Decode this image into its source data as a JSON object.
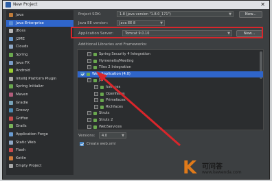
{
  "window": {
    "title": "New Project",
    "close_glyph": "✕"
  },
  "sidebar": {
    "items": [
      {
        "label": "Java",
        "color": "#c07c3a"
      },
      {
        "label": "Java Enterprise",
        "color": "#5a8ed6",
        "selected": true
      },
      {
        "label": "JBoss",
        "color": "#b7b7b7"
      },
      {
        "label": "J2ME",
        "color": "#6a9bd1"
      },
      {
        "label": "Clouds",
        "color": "#8fa7c4"
      },
      {
        "label": "Spring",
        "color": "#6aa84f"
      },
      {
        "label": "Java FX",
        "color": "#7a9cc6"
      },
      {
        "label": "Android",
        "color": "#9acd32"
      },
      {
        "label": "IntelliJ Platform Plugin",
        "color": "#a8a8a8"
      },
      {
        "label": "Spring Initializr",
        "color": "#6aa84f"
      },
      {
        "label": "Maven",
        "color": "#b05c7a"
      },
      {
        "label": "Gradle",
        "color": "#78a3b8"
      },
      {
        "label": "Groovy",
        "color": "#4e8ab3"
      },
      {
        "label": "Griffon",
        "color": "#c94b4b"
      },
      {
        "label": "Grails",
        "color": "#7ab35a"
      },
      {
        "label": "Application Forge",
        "color": "#6a9bd1"
      },
      {
        "label": "Static Web",
        "color": "#8fa7c4"
      },
      {
        "label": "Flash",
        "color": "#c94b4b"
      },
      {
        "label": "Kotlin",
        "color": "#d17a3a"
      },
      {
        "label": "Empty Project",
        "color": "#a8a8a8"
      }
    ]
  },
  "form": {
    "sdk_label": "Project SDK:",
    "sdk_value": "1.8 (java version \"1.8.0_171\")",
    "sdk_new_button": "New...",
    "javaee_label": "Java EE version:",
    "javaee_value": "Java EE 8",
    "server_label": "Application Server:",
    "server_value": "Tomcat 9.0.10",
    "server_new_button": "New...",
    "libraries_label": "Additional Libraries and Frameworks:",
    "versions_label": "Versions:",
    "versions_value": "4.0",
    "create_webxml_label": "Create web.xml"
  },
  "tree": {
    "rows": [
      {
        "label": "Spring Security 4 Integration",
        "indent": 1,
        "checked": false
      },
      {
        "label": "Hymenetis/Meeting",
        "indent": 1,
        "checked": false
      },
      {
        "label": "Tiles 2 Integration",
        "indent": 1,
        "checked": false
      },
      {
        "label": "Web Application (4.0)",
        "indent": 0,
        "checked": true,
        "selected": true
      },
      {
        "label": "JSF",
        "indent": 1,
        "checked": false
      },
      {
        "label": "Icefaces",
        "indent": 2,
        "checked": false
      },
      {
        "label": "Openfaces",
        "indent": 2,
        "checked": false
      },
      {
        "label": "Primefaces",
        "indent": 2,
        "checked": false
      },
      {
        "label": "Richfaces",
        "indent": 2,
        "checked": false
      },
      {
        "label": "Struts",
        "indent": 1,
        "checked": false
      },
      {
        "label": "Struts 2",
        "indent": 1,
        "checked": false
      },
      {
        "label": "WebServices",
        "indent": 1,
        "checked": false
      }
    ]
  },
  "watermark": {
    "logo_letter": "K",
    "cn_text": "可问答",
    "url": "www.kewenda.com"
  },
  "colors": {
    "accent": "#2f65ca",
    "highlight_red": "#d9262b"
  }
}
